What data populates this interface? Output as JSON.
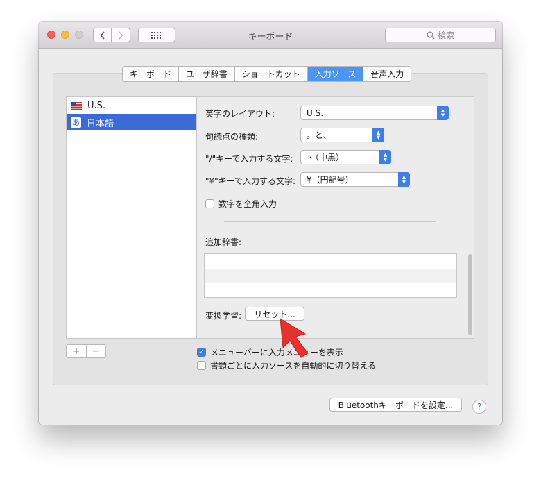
{
  "window": {
    "title": "キーボード",
    "search_placeholder": "検索"
  },
  "tabs": [
    {
      "label": "キーボード",
      "selected": false
    },
    {
      "label": "ユーザ辞書",
      "selected": false
    },
    {
      "label": "ショートカット",
      "selected": false
    },
    {
      "label": "入力ソース",
      "selected": true
    },
    {
      "label": "音声入力",
      "selected": false
    }
  ],
  "sources": [
    {
      "label": "U.S.",
      "icon": "us-flag-icon",
      "selected": false
    },
    {
      "label": "日本語",
      "icon": "a",
      "selected": true
    }
  ],
  "settings": {
    "layout_label": "英字のレイアウト:",
    "layout_value": "U.S.",
    "punct_label": "句読点の種類:",
    "punct_value": "。と、",
    "slash_label": "\"/\"キーで入力する文字:",
    "slash_value": "・（中黒）",
    "yen_label": "\"¥\"キーで入力する文字:",
    "yen_value": "¥（円記号）",
    "fullwidth_label": "数字を全角入力",
    "fullwidth_checked": false,
    "dict_label": "追加辞書:",
    "learn_label": "変換学習:",
    "reset_button": "リセット..."
  },
  "bottom": {
    "add_label": "+",
    "remove_label": "−",
    "show_menu_label": "メニューバーに入力メニューを表示",
    "show_menu_checked": true,
    "auto_switch_label": "書類ごとに入力ソースを自動的に切り替える",
    "auto_switch_checked": false,
    "bluetooth_button": "Bluetoothキーボードを設定...",
    "help_label": "?"
  },
  "colors": {
    "accent": "#3d7ee8",
    "tab_selected": "#4b96f2",
    "list_selected": "#3b6bd6",
    "pointer": "#e8302c"
  }
}
